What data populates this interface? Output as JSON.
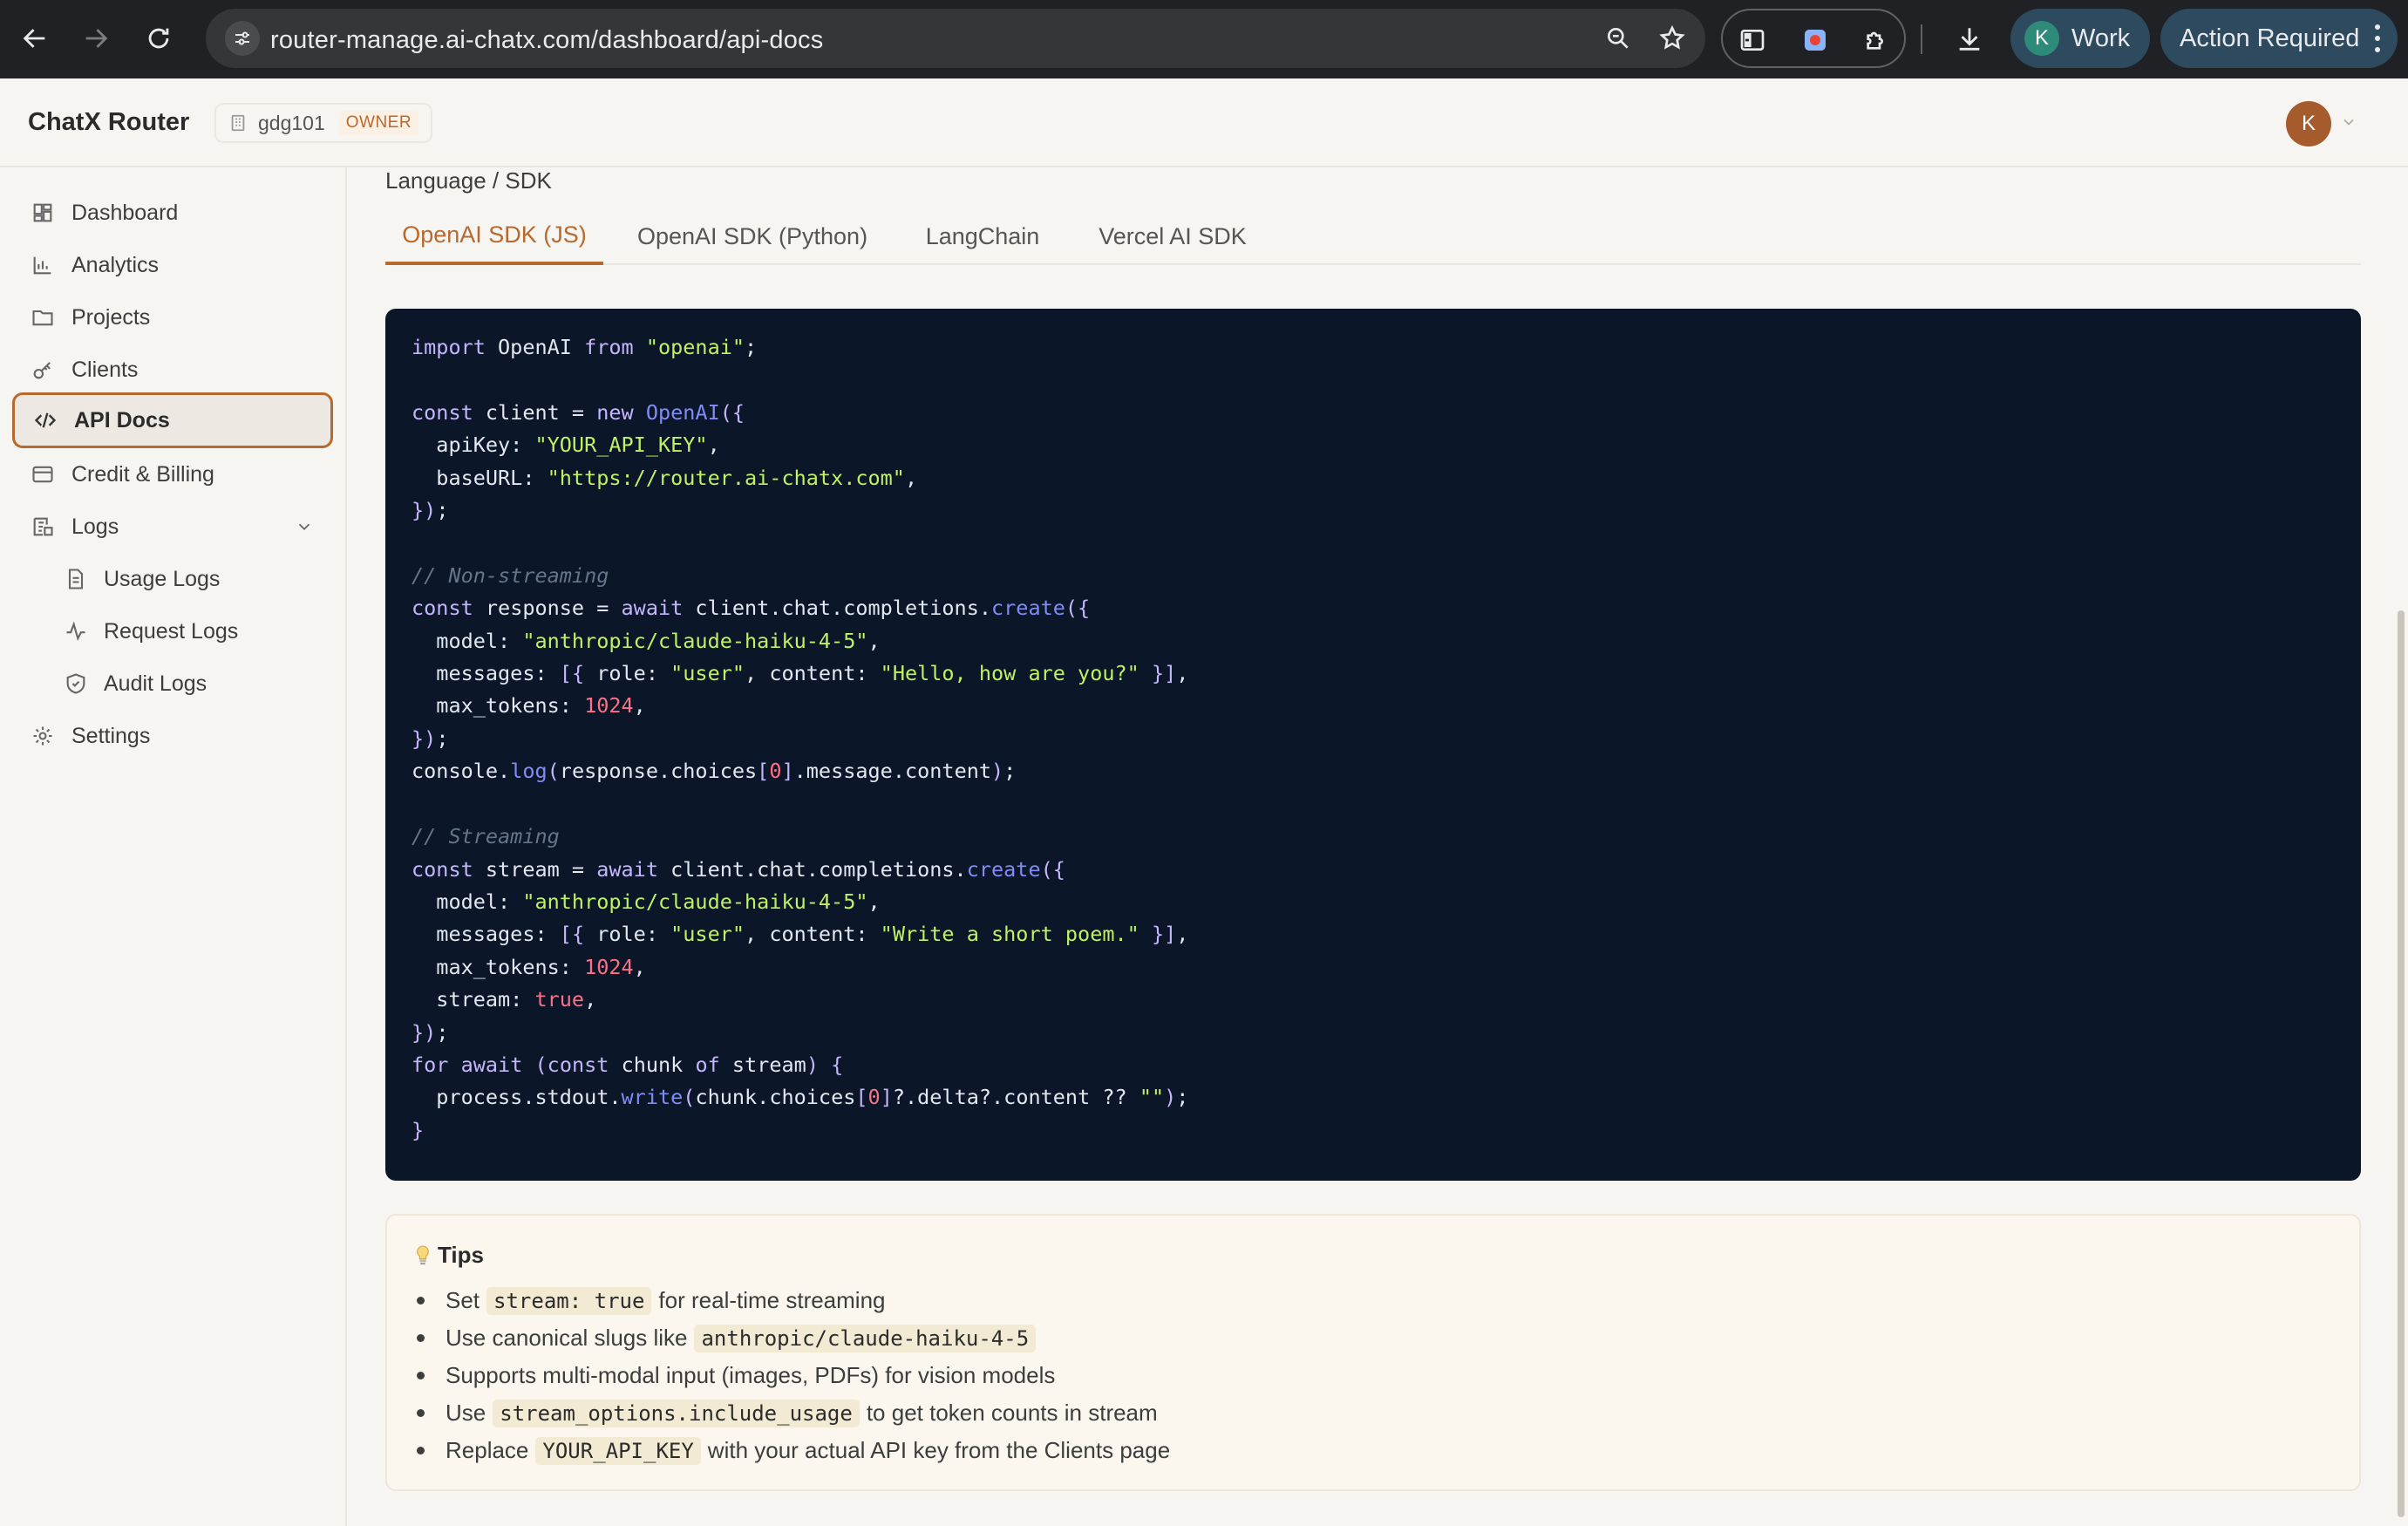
{
  "browser": {
    "url": "router-manage.ai-chatx.com/dashboard/api-docs",
    "profile_initial": "K",
    "profile_label": "Work",
    "action_label": "Action Required"
  },
  "header": {
    "brand": "ChatX Router",
    "org_name": "gdg101",
    "org_role": "OWNER",
    "user_initial": "K"
  },
  "sidebar": {
    "items": [
      {
        "label": "Dashboard",
        "icon": "grid-icon"
      },
      {
        "label": "Analytics",
        "icon": "bar-chart-icon"
      },
      {
        "label": "Projects",
        "icon": "folder-icon"
      },
      {
        "label": "Clients",
        "icon": "key-icon"
      },
      {
        "label": "API Docs",
        "icon": "code-icon",
        "active": true
      },
      {
        "label": "Credit & Billing",
        "icon": "credit-card-icon"
      },
      {
        "label": "Logs",
        "icon": "logs-icon",
        "expanded": true
      },
      {
        "label": "Usage Logs",
        "icon": "file-icon"
      },
      {
        "label": "Request Logs",
        "icon": "activity-icon"
      },
      {
        "label": "Audit Logs",
        "icon": "shield-icon"
      },
      {
        "label": "Settings",
        "icon": "gear-icon"
      }
    ]
  },
  "main": {
    "section_label": "Language / SDK",
    "tabs": [
      "OpenAI SDK (JS)",
      "OpenAI SDK (Python)",
      "LangChain",
      "Vercel AI SDK"
    ],
    "active_tab": 0,
    "code_lines": [
      "import OpenAI from \"openai\";",
      "",
      "const client = new OpenAI({",
      "  apiKey: \"YOUR_API_KEY\",",
      "  baseURL: \"https://router.ai-chatx.com\",",
      "});",
      "",
      "// Non-streaming",
      "const response = await client.chat.completions.create({",
      "  model: \"anthropic/claude-haiku-4-5\",",
      "  messages: [{ role: \"user\", content: \"Hello, how are you?\" }],",
      "  max_tokens: 1024,",
      "});",
      "console.log(response.choices[0].message.content);",
      "",
      "// Streaming",
      "const stream = await client.chat.completions.create({",
      "  model: \"anthropic/claude-haiku-4-5\",",
      "  messages: [{ role: \"user\", content: \"Write a short poem.\" }],",
      "  max_tokens: 1024,",
      "  stream: true,",
      "});",
      "for await (const chunk of stream) {",
      "  process.stdout.write(chunk.choices[0]?.delta?.content ?? \"\");",
      "}"
    ]
  },
  "tips": {
    "title": "Tips",
    "items": [
      {
        "before": "Set",
        "code": "stream: true",
        "after": "for real-time streaming"
      },
      {
        "before": "Use canonical slugs like",
        "code": "anthropic/claude-haiku-4-5",
        "after": ""
      },
      {
        "before": "Supports multi-modal input (images, PDFs) for vision models",
        "code": "",
        "after": ""
      },
      {
        "before": "Use",
        "code": "stream_options.include_usage",
        "after": "to get token counts in stream"
      },
      {
        "before": "Replace",
        "code": "YOUR_API_KEY",
        "after": "with your actual API key from the Clients page"
      }
    ]
  },
  "colors": {
    "accent": "#b8692e",
    "code_bg": "#0b1628",
    "tips_bg": "#fbf7ee"
  }
}
